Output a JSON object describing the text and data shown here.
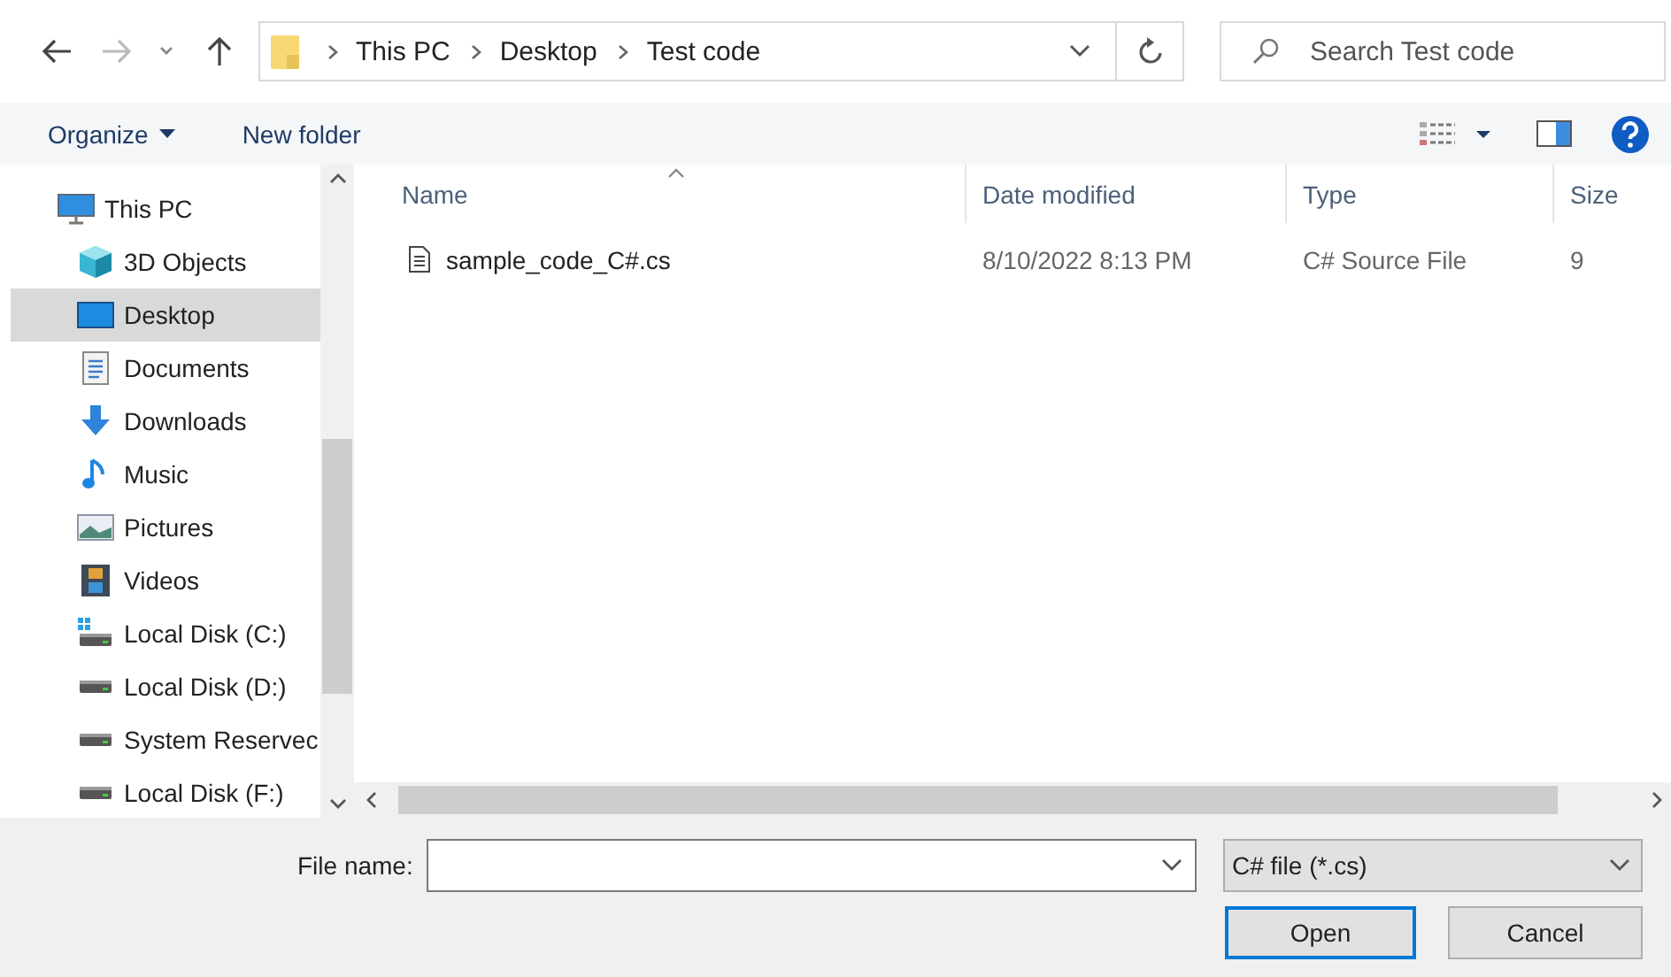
{
  "nav": {
    "back_enabled": true,
    "forward_enabled": false
  },
  "address": {
    "path": [
      "This PC",
      "Desktop",
      "Test code"
    ]
  },
  "search": {
    "placeholder": "Search Test code"
  },
  "toolbar": {
    "organize": "Organize",
    "new_folder": "New folder"
  },
  "sidebar": {
    "items": [
      {
        "label": "This PC",
        "kind": "pc",
        "selected": false,
        "children": [
          {
            "label": "3D Objects",
            "kind": "cube",
            "selected": false
          },
          {
            "label": "Desktop",
            "kind": "desktop",
            "selected": true
          },
          {
            "label": "Documents",
            "kind": "document",
            "selected": false
          },
          {
            "label": "Downloads",
            "kind": "download",
            "selected": false
          },
          {
            "label": "Music",
            "kind": "music",
            "selected": false
          },
          {
            "label": "Pictures",
            "kind": "pictures",
            "selected": false
          },
          {
            "label": "Videos",
            "kind": "videos",
            "selected": false
          },
          {
            "label": "Local Disk (C:)",
            "kind": "system-disk",
            "selected": false
          },
          {
            "label": "Local Disk (D:)",
            "kind": "disk",
            "selected": false
          },
          {
            "label": "System Reservec",
            "kind": "disk",
            "selected": false
          },
          {
            "label": "Local Disk (F:)",
            "kind": "disk",
            "selected": false
          }
        ]
      }
    ]
  },
  "table": {
    "columns": [
      "Name",
      "Date modified",
      "Type",
      "Size"
    ],
    "rows": [
      {
        "name": "sample_code_C#.cs",
        "date": "8/10/2022 8:13 PM",
        "type": "C# Source File",
        "size": "9"
      }
    ]
  },
  "file_name": {
    "label": "File name:"
  },
  "filter": {
    "value": "C# file (*.cs)"
  },
  "buttons": [
    {
      "label": "Open",
      "default": true
    },
    {
      "label": "Cancel",
      "default": false
    }
  ]
}
